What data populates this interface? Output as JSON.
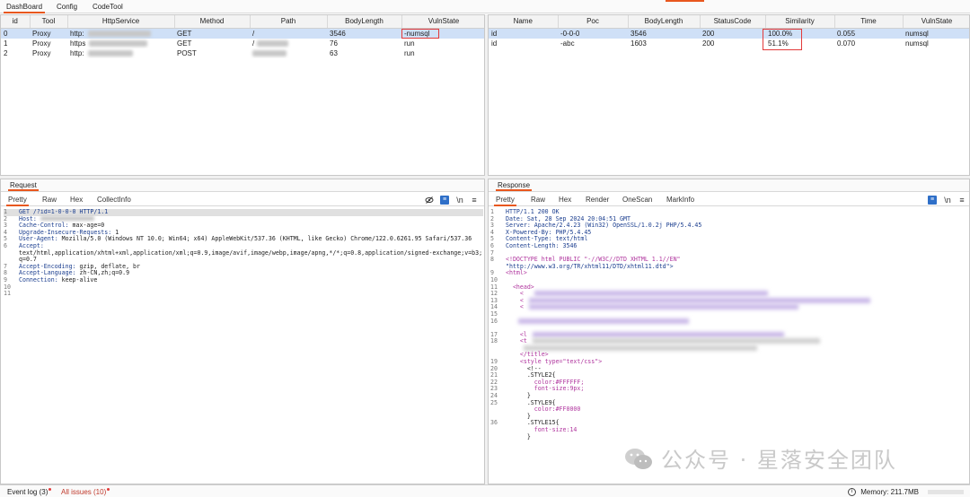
{
  "top_tabs": [
    "DashBoard",
    "Config",
    "CodeTool"
  ],
  "left_table": {
    "columns": [
      "id",
      "Tool",
      "HttpService",
      "Method",
      "Path",
      "BodyLength",
      "VulnState"
    ],
    "rows": [
      {
        "id": "0",
        "tool": "Proxy",
        "service": "http:",
        "method": "GET",
        "path": "/",
        "body": "3546",
        "vuln": "-numsql"
      },
      {
        "id": "1",
        "tool": "Proxy",
        "service": "https",
        "method": "GET",
        "path": "/",
        "body": "76",
        "vuln": "run"
      },
      {
        "id": "2",
        "tool": "Proxy",
        "service": "http:",
        "method": "POST",
        "path": "",
        "body": "63",
        "vuln": "run"
      }
    ]
  },
  "right_table": {
    "columns": [
      "Name",
      "Poc",
      "BodyLength",
      "StatusCode",
      "Similarity",
      "Time",
      "VulnState"
    ],
    "rows": [
      {
        "name": "id",
        "poc": "-0-0-0",
        "body": "3546",
        "status": "200",
        "sim": "100.0%",
        "time": "0.055",
        "vuln": "numsql"
      },
      {
        "name": "id",
        "poc": "-abc",
        "body": "1603",
        "status": "200",
        "sim": "51.1%",
        "time": "0.070",
        "vuln": "numsql"
      }
    ]
  },
  "request": {
    "title": "Request",
    "tabs": [
      "Pretty",
      "Raw",
      "Hex",
      "CollectInfo"
    ],
    "lines": [
      {
        "n": "1",
        "key": "GET /?id=1-0-0-0 HTTP/1.1",
        "val": ""
      },
      {
        "n": "2",
        "key": "Host:",
        "val": ""
      },
      {
        "n": "3",
        "key": "Cache-Control:",
        "val": " max-age=0"
      },
      {
        "n": "4",
        "key": "Upgrade-Insecure-Requests:",
        "val": " 1"
      },
      {
        "n": "5",
        "key": "User-Agent:",
        "val": " Mozilla/5.0 (Windows NT 10.0; Win64; x64) AppleWebKit/537.36 (KHTML, like Gecko) Chrome/122.0.6261.95 Safari/537.36"
      },
      {
        "n": "6",
        "key": "Accept:",
        "val": ""
      },
      {
        "n": "",
        "key": "",
        "val": "text/html,application/xhtml+xml,application/xml;q=0.9,image/avif,image/webp,image/apng,*/*;q=0.8,application/signed-exchange;v=b3;"
      },
      {
        "n": "",
        "key": "",
        "val": "q=0.7"
      },
      {
        "n": "7",
        "key": "Accept-Encoding:",
        "val": " gzip, deflate, br"
      },
      {
        "n": "8",
        "key": "Accept-Language:",
        "val": " zh-CN,zh;q=0.9"
      },
      {
        "n": "9",
        "key": "Connection:",
        "val": " keep-alive"
      },
      {
        "n": "10",
        "key": "",
        "val": ""
      },
      {
        "n": "11",
        "key": "",
        "val": ""
      }
    ]
  },
  "response": {
    "title": "Response",
    "tabs": [
      "Pretty",
      "Raw",
      "Hex",
      "Render",
      "OneScan",
      "MarkInfo"
    ],
    "lines": [
      {
        "n": "1",
        "t": "HTTP/1.1 200 OK"
      },
      {
        "n": "2",
        "t": "Date: Sat, 28 Sep 2024 20:04:51 GMT"
      },
      {
        "n": "3",
        "t": "Server: Apache/2.4.23 (Win32) OpenSSL/1.0.2j PHP/5.4.45"
      },
      {
        "n": "4",
        "t": "X-Powered-By: PHP/5.4.45"
      },
      {
        "n": "5",
        "t": "Content-Type: text/html"
      },
      {
        "n": "6",
        "t": "Content-Length: 3546"
      },
      {
        "n": "7",
        "t": ""
      },
      {
        "n": "8",
        "t": "<!DOCTYPE html PUBLIC \"-//W3C//DTD XHTML 1.1//EN\""
      },
      {
        "n": "",
        "t": "\"http://www.w3.org/TR/xhtml11/DTD/xhtml11.dtd\">"
      },
      {
        "n": "9",
        "t": "<html>"
      },
      {
        "n": "10",
        "t": ""
      },
      {
        "n": "11",
        "t": "  <head>"
      },
      {
        "n": "12",
        "t": "    <"
      },
      {
        "n": "13",
        "t": "    <"
      },
      {
        "n": "14",
        "t": "    <"
      },
      {
        "n": "15",
        "t": ""
      },
      {
        "n": "16",
        "t": ""
      },
      {
        "n": "",
        "t": ""
      },
      {
        "n": "17",
        "t": "    <l"
      },
      {
        "n": "18",
        "t": "    <t"
      },
      {
        "n": "",
        "t": ""
      },
      {
        "n": "",
        "t": "    </title>"
      },
      {
        "n": "19",
        "t": "    <style type=\"text/css\">"
      },
      {
        "n": "20",
        "t": "      <!--"
      },
      {
        "n": "21",
        "t": "      .STYLE2{"
      },
      {
        "n": "22",
        "t": "        color:#FFFFFF;"
      },
      {
        "n": "23",
        "t": "        font-size:9px;"
      },
      {
        "n": "24",
        "t": "      }"
      },
      {
        "n": "25",
        "t": "      .STYLE9{"
      },
      {
        "n": "",
        "t": "        color:#FF0000"
      },
      {
        "n": "",
        "t": "      }"
      },
      {
        "n": "36",
        "t": "      .STYLE15{"
      },
      {
        "n": "",
        "t": "        font-size:14"
      },
      {
        "n": "",
        "t": "      }"
      }
    ]
  },
  "status_bar": {
    "event_log": "Event log (3)",
    "all_issues": "All issues (10)",
    "memory": "Memory: 211.7MB"
  },
  "watermark": "公众号 · 星落安全团队",
  "icons": {
    "eye_off": "eye-off-icon",
    "wrap": "wrap-icon",
    "newline": "newline-icon",
    "memory": "info-icon"
  }
}
